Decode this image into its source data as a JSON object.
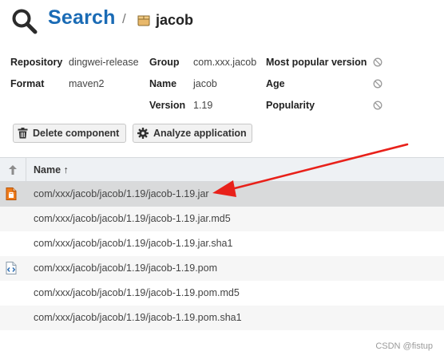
{
  "header": {
    "title": "Search",
    "separator": "/",
    "crumb": "jacob"
  },
  "details": {
    "repository_label": "Repository",
    "repository_value": "dingwei-release",
    "format_label": "Format",
    "format_value": "maven2",
    "group_label": "Group",
    "group_value": "com.xxx.jacob",
    "name_label": "Name",
    "name_value": "jacob",
    "version_label": "Version",
    "version_value": "1.19",
    "most_popular_label": "Most popular version",
    "age_label": "Age",
    "popularity_label": "Popularity"
  },
  "toolbar": {
    "delete_label": "Delete component",
    "analyze_label": "Analyze application"
  },
  "table": {
    "name_header": "Name ↑",
    "sort_glyph": "↑",
    "rows": [
      {
        "path": "com/xxx/jacob/jacob/1.19/jacob-1.19.jar",
        "icon": "jar-file-icon",
        "selected": true
      },
      {
        "path": "com/xxx/jacob/jacob/1.19/jacob-1.19.jar.md5",
        "icon": "",
        "selected": false
      },
      {
        "path": "com/xxx/jacob/jacob/1.19/jacob-1.19.jar.sha1",
        "icon": "",
        "selected": false
      },
      {
        "path": "com/xxx/jacob/jacob/1.19/jacob-1.19.pom",
        "icon": "pom-file-icon",
        "selected": false
      },
      {
        "path": "com/xxx/jacob/jacob/1.19/jacob-1.19.pom.md5",
        "icon": "",
        "selected": false
      },
      {
        "path": "com/xxx/jacob/jacob/1.19/jacob-1.19.pom.sha1",
        "icon": "",
        "selected": false
      }
    ]
  },
  "watermark": "CSDN @fistup",
  "colors": {
    "accent": "#1a6bb5",
    "arrow": "#e8211a",
    "selected_row": "#d9dadb"
  }
}
